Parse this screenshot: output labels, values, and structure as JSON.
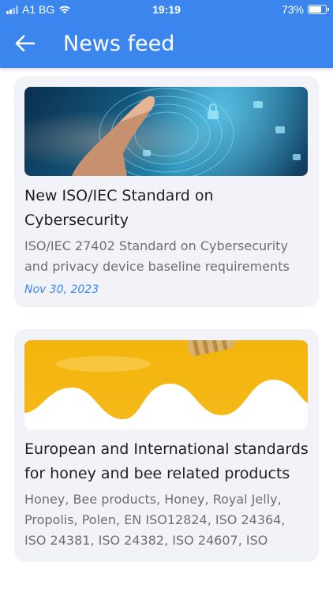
{
  "status_bar": {
    "carrier": "A1 BG",
    "time": "19:19",
    "battery": "73%",
    "battery_level": 0.73
  },
  "app_bar": {
    "title": "News feed",
    "back_icon": "arrow-left-icon"
  },
  "colors": {
    "accent": "#3b86ee",
    "card_background": "#f1f3f9",
    "date": "#3b86ee"
  },
  "articles": [
    {
      "title": "New ISO/IEC Standard on Cybersecurity",
      "description": "ISO/IEC 27402 Standard on Cybersecurity and privacy device baseline requirements",
      "date": "Nov 30, 2023"
    },
    {
      "title": "European and International standards for honey and bee related products",
      "description": "Honey,  Bee products, Honey, Royal Jelly, Propolis, Polen, EN ISO12824, ISO 24364, ISO 24381, ISO 24382, ISO 24607, ISO"
    }
  ]
}
